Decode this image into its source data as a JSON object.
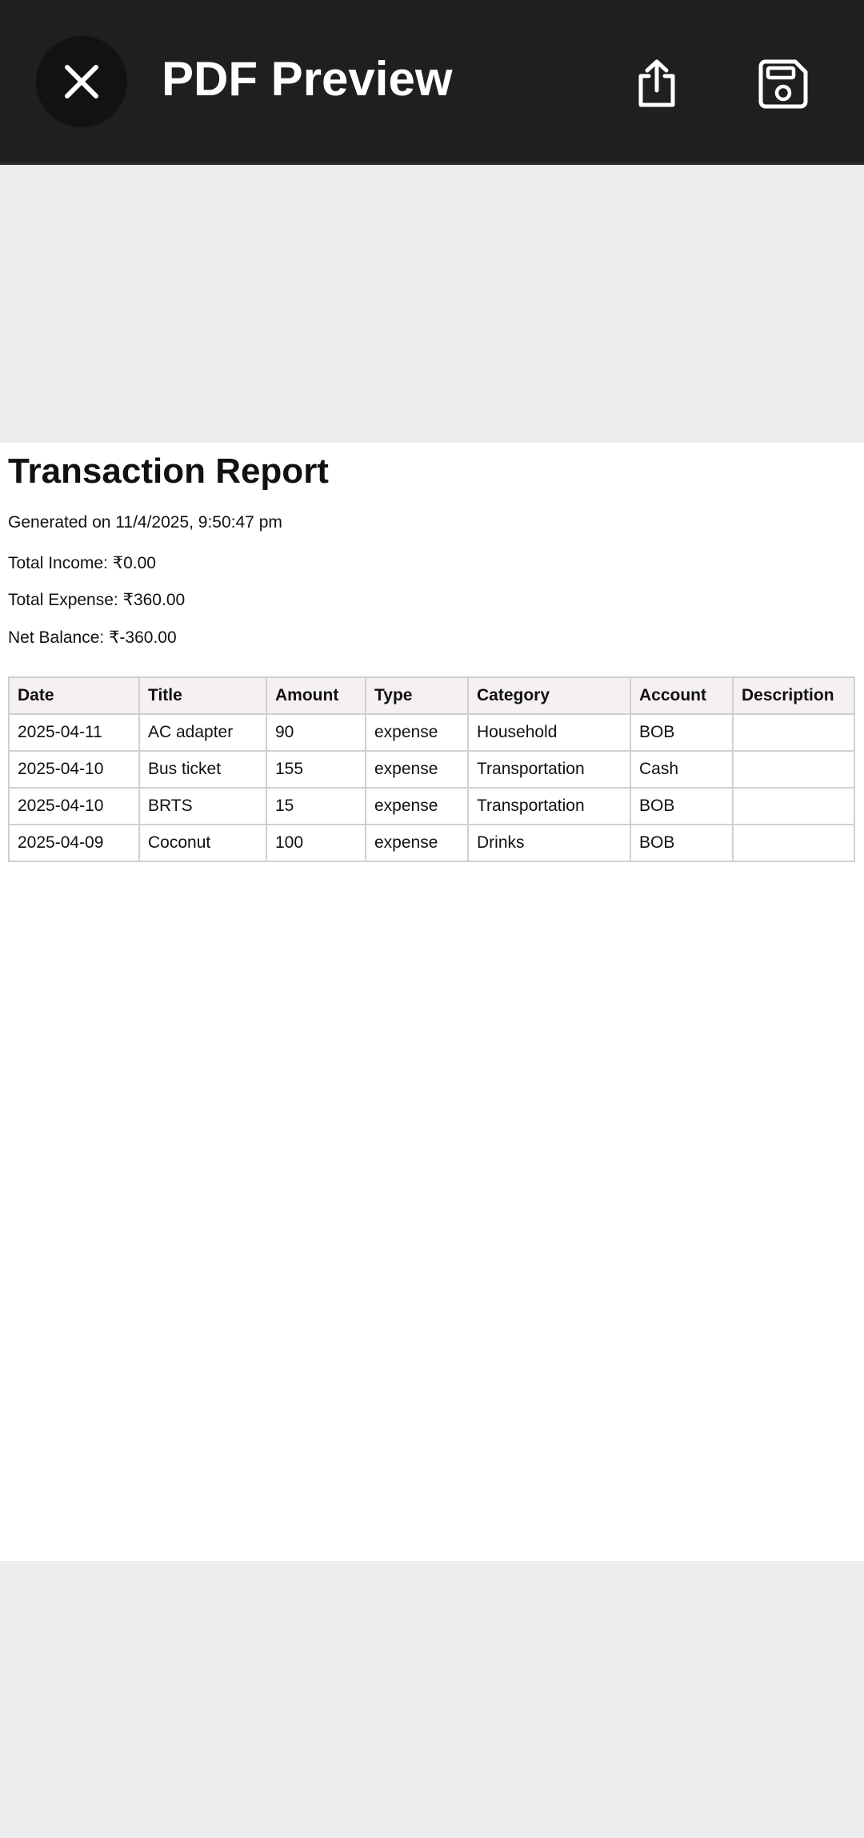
{
  "appbar": {
    "title": "PDF Preview",
    "close_icon": "close-icon",
    "share_icon": "share-icon",
    "save_icon": "save-icon"
  },
  "colors": {
    "appbar_bg": "#1f1f1f",
    "close_bg": "#121212",
    "preview_bg": "#ededed",
    "page_bg": "#ffffff",
    "table_header_bg": "#f5f0f4",
    "table_border": "#d0d0d0"
  },
  "report": {
    "title": "Transaction Report",
    "generated": "Generated on 11/4/2025, 9:50:47 pm",
    "total_income": "Total Income: ₹0.00",
    "total_expense": "Total Expense: ₹360.00",
    "net_balance": "Net Balance: ₹-360.00",
    "table": {
      "headers": [
        "Date",
        "Title",
        "Amount",
        "Type",
        "Category",
        "Account",
        "Description"
      ],
      "rows": [
        [
          "2025-04-11",
          "AC adapter",
          "90",
          "expense",
          "Household",
          "BOB",
          ""
        ],
        [
          "2025-04-10",
          "Bus ticket",
          "155",
          "expense",
          "Transportation",
          "Cash",
          ""
        ],
        [
          "2025-04-10",
          "BRTS",
          "15",
          "expense",
          "Transportation",
          "BOB",
          ""
        ],
        [
          "2025-04-09",
          "Coconut",
          "100",
          "expense",
          "Drinks",
          "BOB",
          ""
        ]
      ]
    }
  }
}
